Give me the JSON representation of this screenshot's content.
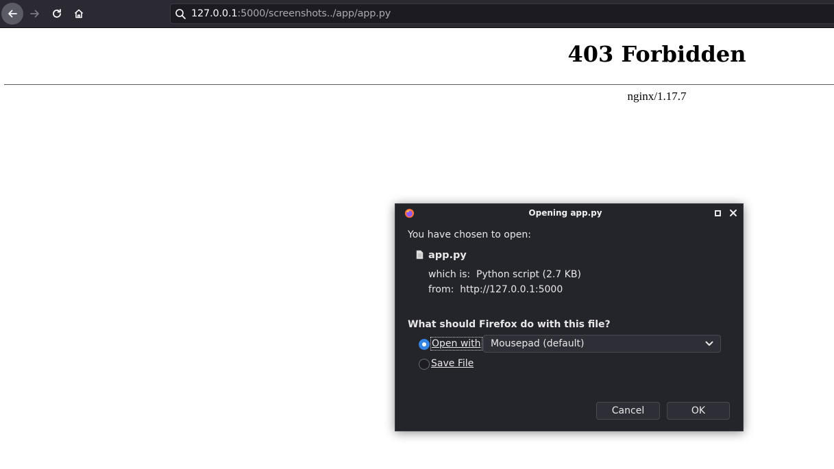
{
  "browser": {
    "url_host": "127.0.0.1",
    "url_rest": ":5000/screenshots../app/app.py",
    "icons": {
      "back": "back-arrow-icon",
      "forward": "forward-arrow-icon",
      "reload": "reload-icon",
      "home": "home-icon",
      "search": "search-icon"
    }
  },
  "page": {
    "title": "403 Forbidden",
    "server": "nginx/1.17.7"
  },
  "dialog": {
    "title": "Opening app.py",
    "chosen_label": "You have chosen to open:",
    "filename": "app.py",
    "which_is_label": "which is:",
    "which_is_value": "Python script (2.7 KB)",
    "from_label": "from:",
    "from_value": "http://127.0.0.1:5000",
    "question": "What should Firefox do with this file?",
    "open_with_label": "Open with",
    "open_with_app": "Mousepad (default)",
    "save_file_label": "Save File",
    "cancel_label": "Cancel",
    "ok_label": "OK",
    "colors": {
      "background": "#24242b",
      "accent": "#3584e4"
    }
  }
}
